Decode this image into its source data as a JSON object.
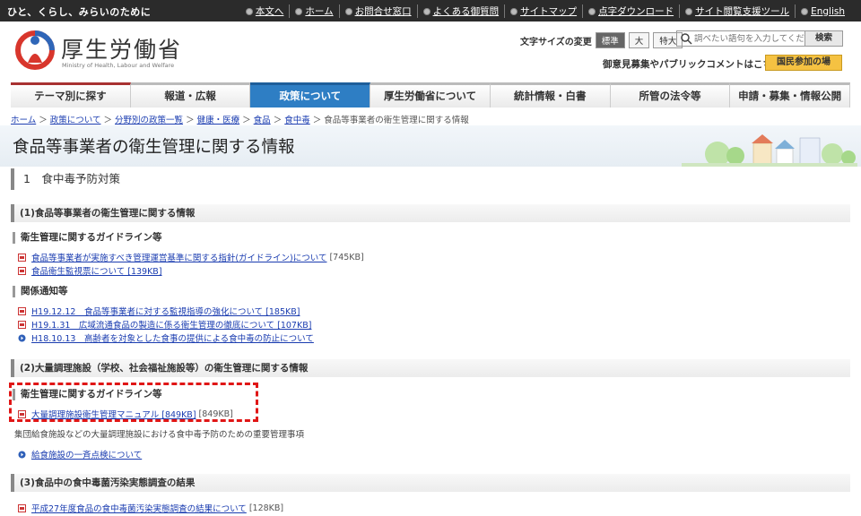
{
  "topbar": {
    "tagline": "ひと、くらし、みらいのために",
    "links": [
      "本文へ",
      "ホーム",
      "お問合せ窓口",
      "よくある御質問",
      "サイトマップ",
      "点字ダウンロード",
      "サイト閲覧支援ツール",
      "English"
    ]
  },
  "header": {
    "logo_text": "厚生労働省",
    "logo_sub": "Ministry of Health, Labour and Welfare",
    "fontsize_label": "文字サイズの変更",
    "fontsize_options": [
      "標準",
      "大",
      "特大"
    ],
    "search_placeholder": "調べたい語句を入力してください",
    "search_button": "検索",
    "opinion_link": "御意見募集やパブリックコメントはこちら",
    "citizen_button": "国民参加の場"
  },
  "nav": [
    "テーマ別に探す",
    "報道・広報",
    "政策について",
    "厚生労働省について",
    "統計情報・白書",
    "所管の法令等",
    "申請・募集・情報公開"
  ],
  "breadcrumb": {
    "items": [
      "ホーム",
      "政策について",
      "分野別の政策一覧",
      "健康・医療",
      "食品",
      "食中毒"
    ],
    "current": "食品等事業者の衛生管理に関する情報"
  },
  "page_title": "食品等事業者の衛生管理に関する情報",
  "section1": {
    "title": "1　食中毒予防対策"
  },
  "block1": {
    "title": "(1)食品等事業者の衛生管理に関する情報",
    "guideline_heading": "衛生管理に関するガイドライン等",
    "guideline_links": [
      {
        "text": "食品等事業者が実施すべき管理運営基準に関する指針(ガイドライン)について",
        "size": "[745KB]"
      },
      {
        "text": "食品衛生監視票について [139KB]",
        "size": ""
      }
    ],
    "notice_heading": "関係通知等",
    "notice_links": [
      {
        "text": "H19.12.12　食品等事業者に対する監視指導の強化について [185KB]",
        "size": ""
      },
      {
        "text": "H19.1.31　広域流通食品の製造に係る衛生管理の徹底について [107KB]",
        "size": ""
      },
      {
        "text": "H18.10.13　高齢者を対象とした食事の提供による食中毒の防止について",
        "size": ""
      }
    ]
  },
  "block2": {
    "title": "(2)大量調理施設（学校、社会福祉施設等）の衛生管理に関する情報",
    "guideline_heading": "衛生管理に関するガイドライン等",
    "manual_link": {
      "text": "大量調理施設衛生管理マニュアル [849KB]",
      "size": "[849KB]"
    },
    "note": "集団給食施設などの大量調理施設における食中毒予防のための重要管理事項",
    "check_link": "給食施設の一斉点検について"
  },
  "block3": {
    "title": "(3)食品中の食中毒菌汚染実態調査の結果",
    "survey_link": {
      "text": "平成27年度食品の食中毒菌汚染実態調査の結果について",
      "size": "[128KB]"
    }
  },
  "colors": {
    "nav_active": "#2e7ec4",
    "highlight_box": "#e01616",
    "link": "#1a3cb0"
  }
}
